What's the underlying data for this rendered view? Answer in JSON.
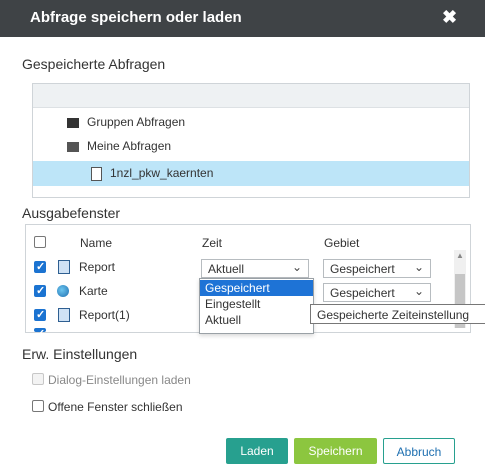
{
  "dialog": {
    "title": "Abfrage speichern oder laden",
    "close_glyph": "✖"
  },
  "saved": {
    "label": "Gespeicherte Abfragen",
    "nodes": [
      {
        "label": "Gruppen Abfragen",
        "icon": "folder-icon"
      },
      {
        "label": "Meine Abfragen",
        "icon": "folder-open-icon"
      },
      {
        "label": "1nzl_pkw_kaernten",
        "icon": "document-icon",
        "selected": true
      }
    ]
  },
  "output": {
    "label": "Ausgabefenster",
    "headers": {
      "name": "Name",
      "time": "Zeit",
      "area": "Gebiet"
    },
    "rows": [
      {
        "checked": true,
        "icon": "report-icon",
        "name": "Report",
        "time": "Aktuell",
        "area": "Gespeichert"
      },
      {
        "checked": true,
        "icon": "globe-icon",
        "name": "Karte",
        "time": "",
        "area": "Gespeichert"
      },
      {
        "checked": true,
        "icon": "report-icon",
        "name": "Report(1)",
        "time": "",
        "area": ""
      }
    ],
    "chevron": "⌄",
    "time_options": [
      "Gespeichert",
      "Eingestellt",
      "Aktuell"
    ],
    "highlighted_option": "Gespeichert",
    "tooltip": "Gespeicherte Zeiteinstellung"
  },
  "advanced": {
    "label": "Erw. Einstellungen",
    "load_dialog_settings": "Dialog-Einstellungen laden",
    "close_open_windows": "Offene Fenster schließen"
  },
  "buttons": {
    "load": "Laden",
    "save": "Speichern",
    "cancel": "Abbruch"
  },
  "colors": {
    "title_bar": "#3f4346",
    "selection": "#bde5f8",
    "check_blue": "#1b73d1",
    "teal": "#27a08f",
    "green": "#8cc63f"
  }
}
